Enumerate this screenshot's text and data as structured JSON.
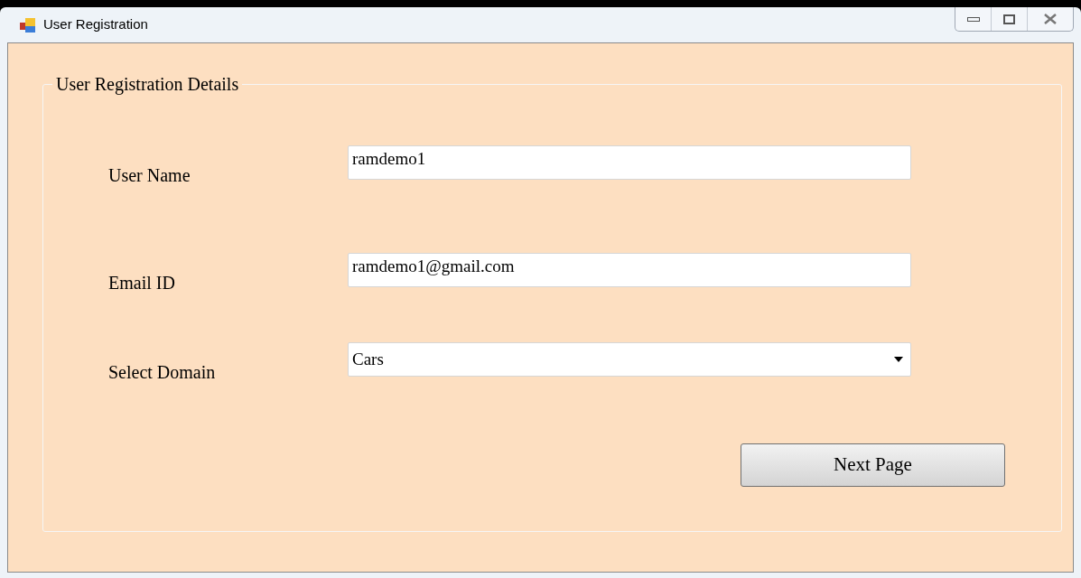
{
  "window": {
    "title": "User Registration"
  },
  "group": {
    "title": "User Registration Details"
  },
  "fields": [
    {
      "kind": "text",
      "label": "User Name",
      "value": "ramdemo1"
    },
    {
      "kind": "text",
      "label": "Email ID",
      "value": "ramdemo1@gmail.com"
    },
    {
      "kind": "dropdown",
      "label": "Select Domain",
      "value": "Cars"
    }
  ],
  "buttons": [
    "Next Page"
  ]
}
